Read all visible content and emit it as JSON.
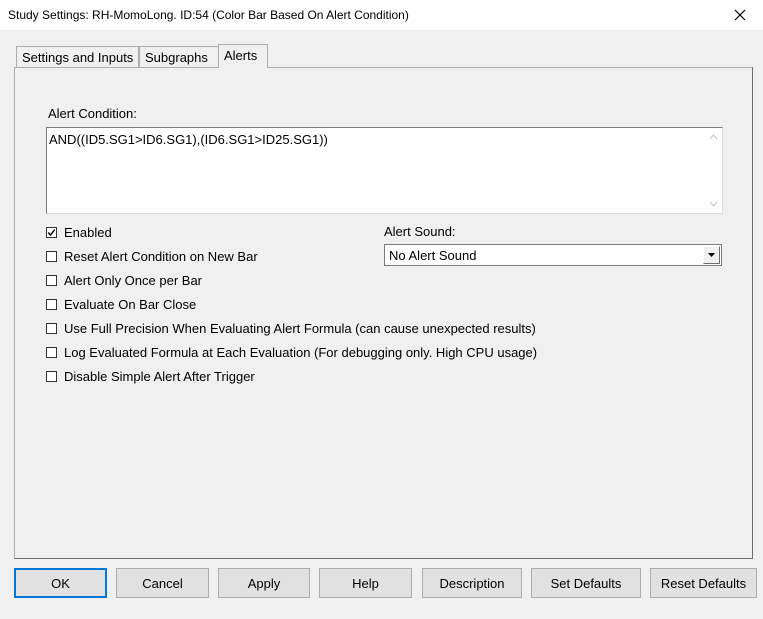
{
  "window": {
    "title": "Study Settings: RH-MomoLong. ID:54 (Color Bar Based On Alert Condition)"
  },
  "tabs": [
    {
      "label": "Settings and Inputs"
    },
    {
      "label": "Subgraphs"
    },
    {
      "label": "Alerts"
    }
  ],
  "alerts": {
    "condition_label": "Alert Condition:",
    "condition_value": "AND((ID5.SG1>ID6.SG1),(ID6.SG1>ID25.SG1))",
    "sound_label": "Alert Sound:",
    "sound_value": "No Alert Sound",
    "options": [
      {
        "label": "Enabled",
        "checked": true
      },
      {
        "label": "Reset Alert Condition on New Bar",
        "checked": false
      },
      {
        "label": "Alert Only Once per Bar",
        "checked": false
      },
      {
        "label": "Evaluate On Bar Close",
        "checked": false
      },
      {
        "label": "Use Full Precision When Evaluating Alert Formula (can cause unexpected results)",
        "checked": false
      },
      {
        "label": "Log Evaluated Formula at Each Evaluation (For debugging only. High CPU usage)",
        "checked": false
      },
      {
        "label": "Disable Simple Alert After Trigger",
        "checked": false
      }
    ]
  },
  "buttons": {
    "ok": "OK",
    "cancel": "Cancel",
    "apply": "Apply",
    "help": "Help",
    "description": "Description",
    "set_defaults": "Set Defaults",
    "reset_defaults": "Reset Defaults"
  },
  "icons": {
    "close": "close-icon",
    "check": "checkmark-icon",
    "dropdown": "chevron-down-icon"
  }
}
